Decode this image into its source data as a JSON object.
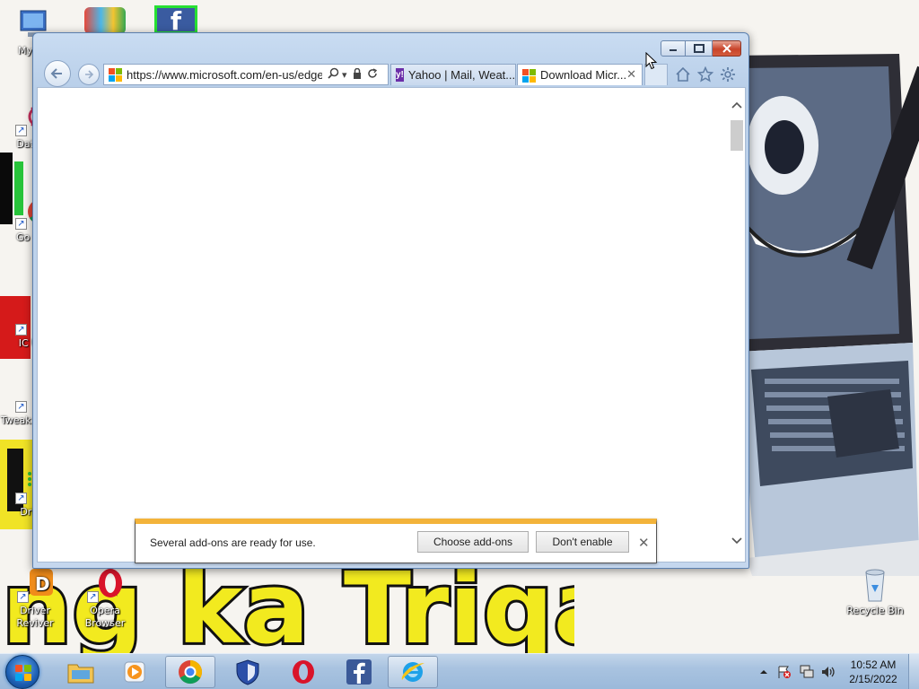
{
  "desktop": {
    "icons": [
      {
        "label": "My Co"
      },
      {
        "label": "DataW"
      },
      {
        "label": "Go Chr"
      },
      {
        "label": "IC Unl"
      },
      {
        "label": "Tweak - Wind"
      },
      {
        "label": "Drive"
      },
      {
        "label": "Driver Reviver"
      },
      {
        "label": "Opera Browser"
      },
      {
        "label": "Recycle Bin"
      }
    ],
    "wallpaper_text": "ng ka Triqa"
  },
  "browser": {
    "address": "https://www.microsoft.com/en-us/edge",
    "tabs": [
      {
        "label": "Yahoo | Mail, Weat...",
        "icon": "yahoo-icon"
      },
      {
        "label": "Download Micr...",
        "icon": "microsoft-logo-icon"
      }
    ],
    "close_tab_glyph": "✕",
    "notification": {
      "message": "Several add-ons are ready for use.",
      "choose_label": "Choose add-ons",
      "dont_enable_label": "Don't enable",
      "close_glyph": "✕"
    }
  },
  "taskbar": {
    "apps": [
      {
        "name": "windows-explorer"
      },
      {
        "name": "media-player"
      },
      {
        "name": "google-chrome"
      },
      {
        "name": "security-shield"
      },
      {
        "name": "opera"
      },
      {
        "name": "facebook"
      },
      {
        "name": "internet-explorer"
      }
    ],
    "time": "10:52 AM",
    "date": "2/15/2022"
  },
  "colors": {
    "notification_accent": "#f3b33a",
    "close_button": "#c8442a",
    "taskbar": "#a9c3e0"
  }
}
